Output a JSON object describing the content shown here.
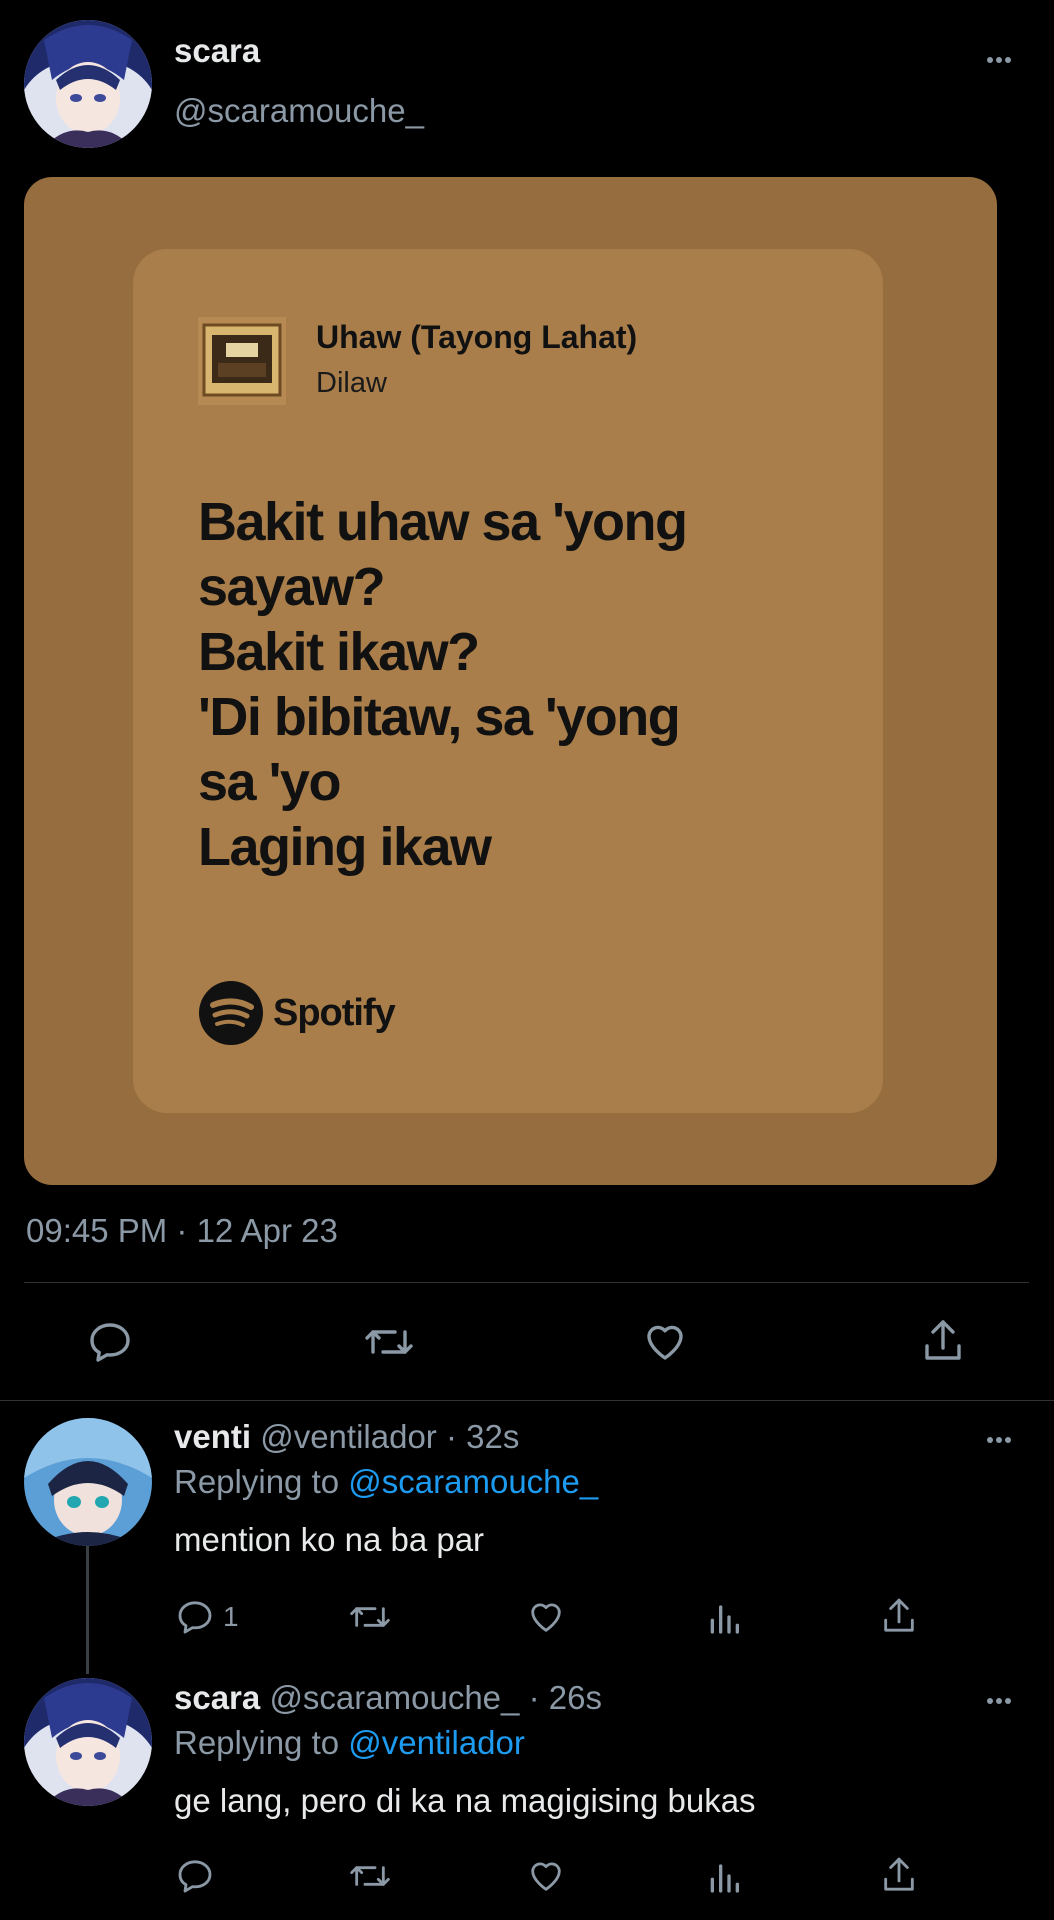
{
  "main_tweet": {
    "display_name": "scara",
    "handle": "@scaramouche_",
    "timestamp": "09:45 PM · 12 Apr 23",
    "spotify_card": {
      "song_title": "Uhaw (Tayong Lahat)",
      "artist": "Dilaw",
      "lyrics": [
        "Bakit uhaw sa 'yong",
        "sayaw?",
        "Bakit ikaw?",
        "'Di bibitaw, sa 'yong",
        "sa 'yo",
        "Laging ikaw"
      ],
      "brand": "Spotify",
      "outer_color": "#956d3f",
      "inner_color": "#a97e4a"
    },
    "actions": [
      "reply-icon",
      "retweet-icon",
      "like-icon",
      "share-icon"
    ]
  },
  "replies": [
    {
      "display_name": "venti",
      "handle": "@ventilador",
      "separator": "·",
      "time": "32s",
      "replying_prefix": "Replying to",
      "replying_to": "@scaramouche_",
      "text": "mention ko na ba par",
      "reply_count": "1"
    },
    {
      "display_name": "scara",
      "handle": "@scaramouche_",
      "separator": "·",
      "time": "26s",
      "replying_prefix": "Replying to",
      "replying_to": "@ventilador",
      "text": "ge lang, pero di ka na magigising bukas",
      "reply_count": ""
    }
  ],
  "colors": {
    "background": "#000000",
    "text": "#e7e9ea",
    "secondary": "#8b98a5",
    "link": "#1d9bf0",
    "divider": "#2f3336"
  }
}
